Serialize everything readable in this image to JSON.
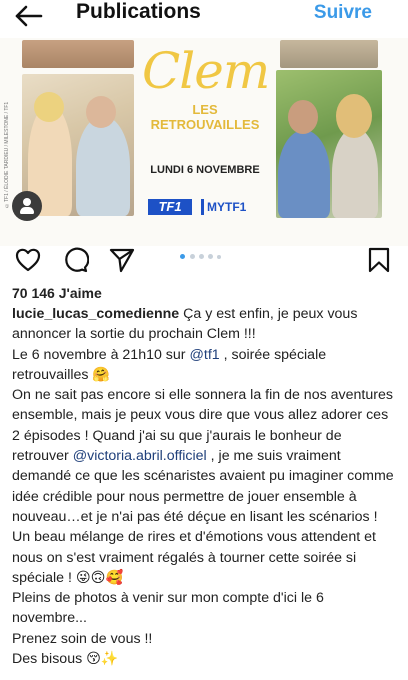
{
  "header": {
    "title": "Publications",
    "follow_label": "Suivre",
    "back_icon": "back-arrow-icon"
  },
  "media": {
    "show_title": "Clem",
    "subtitle": "LES RETROUVAILLES",
    "date": "LUNDI 6 NOVEMBRE",
    "channel": "TF1",
    "platform": "MYTF1",
    "photo_credit": "©TF1 / ÉLODIE TARDIEU / MILESTONE / TF1",
    "carousel_dots": 5,
    "carousel_active": 1
  },
  "actions": {
    "like_icon": "heart-icon",
    "comment_icon": "comment-icon",
    "share_icon": "send-icon",
    "save_icon": "bookmark-icon"
  },
  "likes_text": "70 146 J'aime",
  "caption": {
    "username": "lucie_lucas_comedienne",
    "line1": " Ça y est enfin, je peux vous annoncer la sortie du prochain Clem !!!",
    "line2_a": "Le 6 novembre à 21h10 sur ",
    "mention_tf1": "@tf1",
    "line2_b": " , soirée spéciale retrouvailles 🤗",
    "para_a": "On ne sait pas encore si elle sonnera la fin de nos aventures ensemble, mais je peux vous dire que vous allez adorer ces 2 épisodes ! Quand j'ai su que j'aurais le bonheur de retrouver ",
    "mention_victoria": "@victoria.abril.officiel",
    "para_b": " , je me suis vraiment demandé ce que les scénaristes avaient pu imaginer comme idée crédible pour nous permettre de jouer ensemble à nouveau…et je n'ai pas été déçue en lisant les scénarios ! Un beau mélange de rires et d'émotions vous attendent et nous on s'est vraiment régalés à tourner cette soirée si spéciale ! 😜🙃🥰",
    "line_photos": "Pleins de photos à venir sur mon compte d'ici le 6 novembre...",
    "line_care": "Prenez soin de vous !!",
    "line_bisous": "Des bisous 😚✨"
  }
}
